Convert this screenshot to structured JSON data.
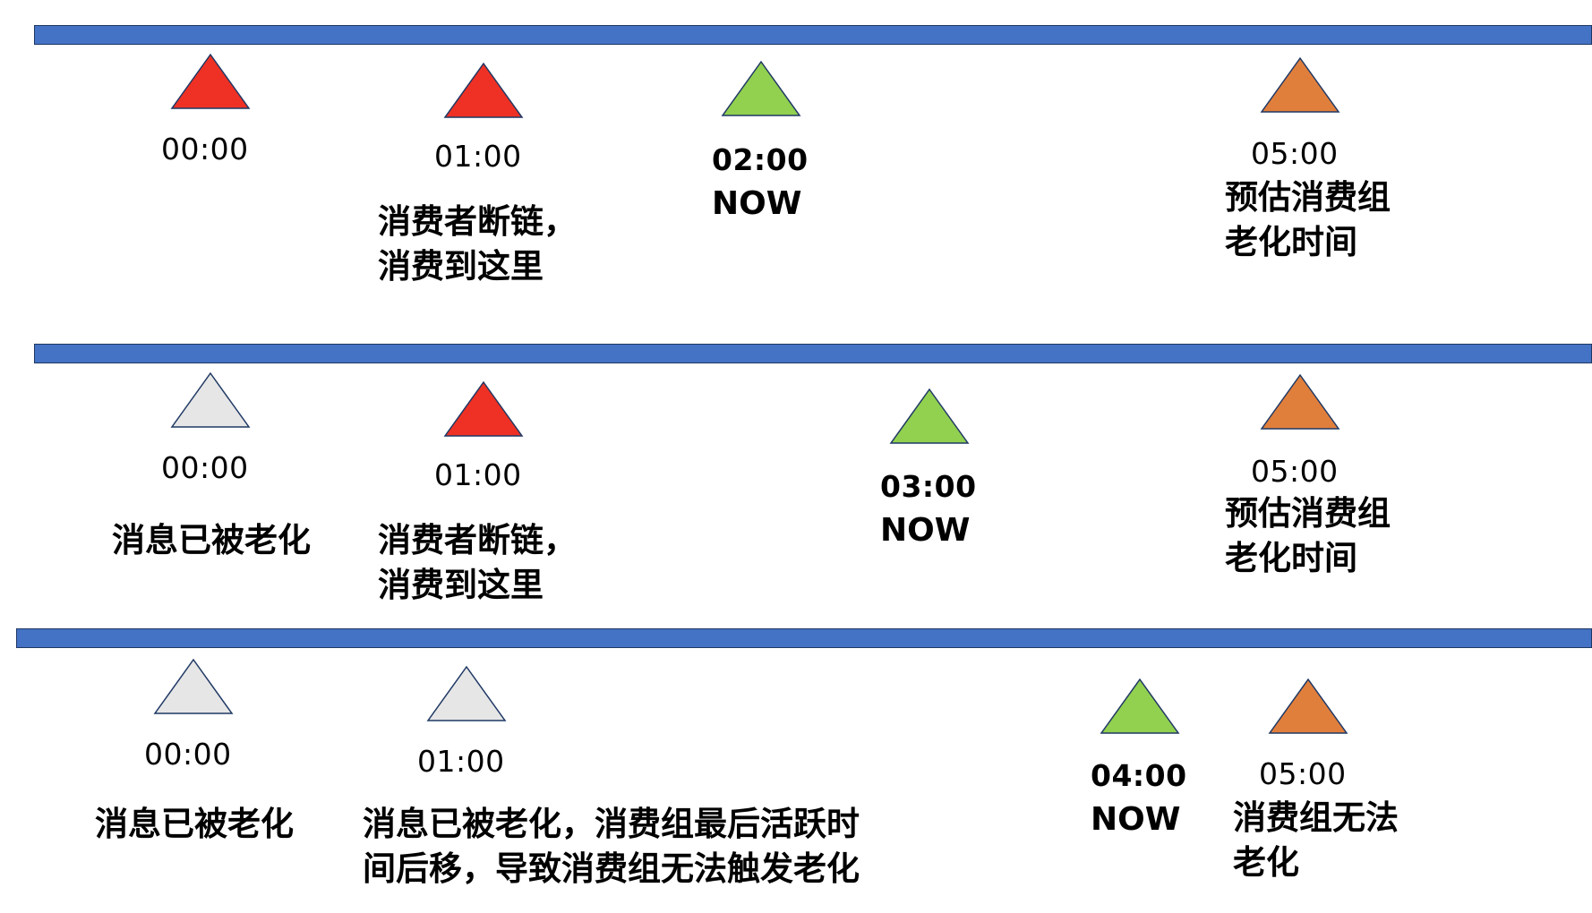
{
  "colors": {
    "bar": "#4472c4",
    "red": "#ee3124",
    "green": "#92d050",
    "orange": "#e07f3c",
    "gray": "#e6e6e6",
    "outline": "#1f3864"
  },
  "row1": {
    "t0": "00:00",
    "t1": "01:00",
    "t1_note": "消费者断链，\n消费到这里",
    "now_time": "02:00",
    "now_label": "NOW",
    "t5": "05:00",
    "t5_note": "预估消费组\n老化时间"
  },
  "row2": {
    "t0": "00:00",
    "t0_note": "消息已被老化",
    "t1": "01:00",
    "t1_note": "消费者断链，\n消费到这里",
    "now_time": "03:00",
    "now_label": "NOW",
    "t5": "05:00",
    "t5_note": "预估消费组\n老化时间"
  },
  "row3": {
    "t0": "00:00",
    "t0_note": "消息已被老化",
    "t1": "01:00",
    "t1_note": "消息已被老化，消费组最后活跃时\n间后移，导致消费组无法触发老化",
    "now_time": "04:00",
    "now_label": "NOW",
    "t5": "05:00",
    "t5_note": "消费组无法\n老化"
  }
}
